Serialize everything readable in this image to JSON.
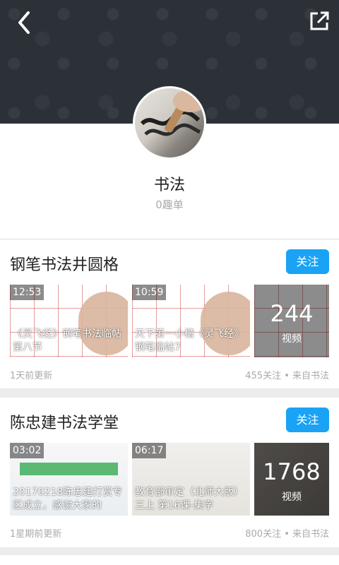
{
  "header": {
    "back_icon": "chevron-left-icon",
    "share_icon": "external-link-icon"
  },
  "profile": {
    "title": "书法",
    "subtitle": "0趣单"
  },
  "cards": [
    {
      "title": "钢笔书法井圆格",
      "follow_label": "关注",
      "videos": [
        {
          "duration": "12:53",
          "caption": "《灵飞经》钢笔书法临帖第八节"
        },
        {
          "duration": "10:59",
          "caption": "天下第一小楷《灵飞经》钢笔临帖7"
        }
      ],
      "count": {
        "number": "244",
        "label": "视频"
      },
      "updated": "1天前更新",
      "stats": "455关注 • 来自书法"
    },
    {
      "title": "陈忠建书法学堂",
      "follow_label": "关注",
      "videos": [
        {
          "duration": "03:02",
          "caption": "20170218陈忠建打赏专区成立，感谢大家的"
        },
        {
          "duration": "06:17",
          "caption": "教育部审定（北师大版）三上 第16课-集字"
        }
      ],
      "count": {
        "number": "1768",
        "label": "视频"
      },
      "updated": "1星期前更新",
      "stats": "800关注 • 来自书法"
    }
  ]
}
